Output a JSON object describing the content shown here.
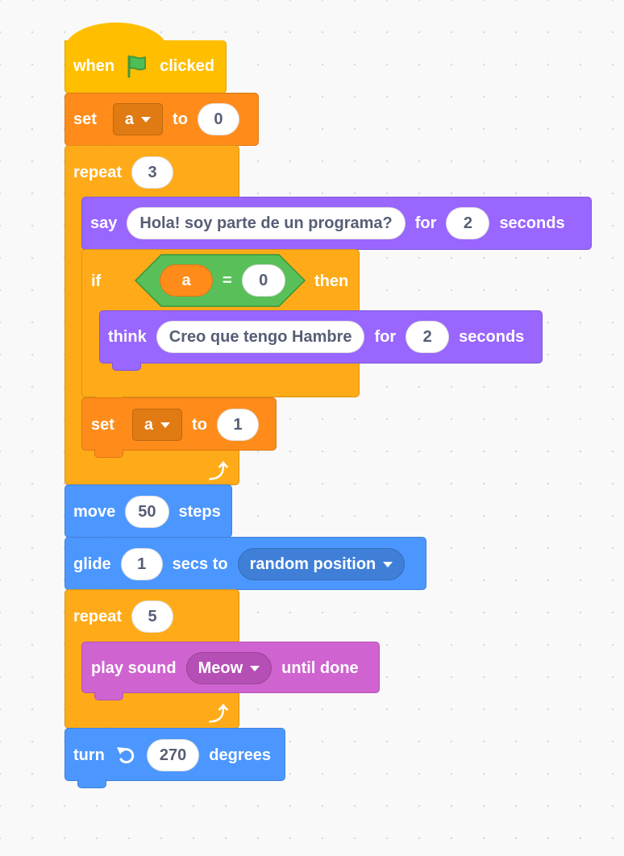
{
  "script": {
    "when_flag": {
      "when": "when",
      "clicked": "clicked",
      "icon": "green-flag-icon"
    },
    "set_a_0": {
      "label": "set",
      "var": "a",
      "to": "to",
      "value": "0"
    },
    "repeat_3": {
      "label": "repeat",
      "count": "3"
    },
    "say": {
      "label": "say",
      "message": "Hola! soy parte de un programa?",
      "for": "for",
      "secs": "2",
      "seconds": "seconds"
    },
    "if_block": {
      "label": "if",
      "then": "then"
    },
    "condition": {
      "var": "a",
      "op": "=",
      "value": "0"
    },
    "think": {
      "label": "think",
      "message": "Creo que tengo Hambre",
      "for": "for",
      "secs": "2",
      "seconds": "seconds"
    },
    "set_a_1": {
      "label": "set",
      "var": "a",
      "to": "to",
      "value": "1"
    },
    "move": {
      "label": "move",
      "steps_value": "50",
      "steps": "steps"
    },
    "glide": {
      "label": "glide",
      "secs_value": "1",
      "secs_to": "secs to",
      "target": "random position"
    },
    "repeat_5": {
      "label": "repeat",
      "count": "5"
    },
    "play_sound": {
      "label": "play sound",
      "sound": "Meow",
      "until_done": "until done"
    },
    "turn": {
      "label": "turn",
      "degrees_value": "270",
      "degrees": "degrees",
      "icon": "rotate-left-icon"
    }
  },
  "colors": {
    "events": "#ffbf00",
    "variables": "#ff8c1a",
    "control": "#ffab19",
    "looks": "#9966ff",
    "operators": "#59c059",
    "motion": "#4c97ff",
    "sound": "#cf63cf"
  }
}
